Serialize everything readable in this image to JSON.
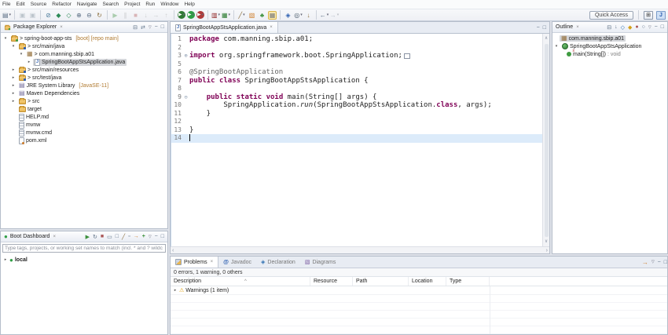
{
  "menu_bar": {
    "items": [
      "File",
      "Edit",
      "Source",
      "Refactor",
      "Navigate",
      "Search",
      "Project",
      "Run",
      "Window",
      "Help"
    ]
  },
  "toolbar": {
    "quick_access_label": "Quick Access",
    "items": [
      {
        "name": "new-wizard",
        "glyph": "▤",
        "dropdown": true
      },
      {
        "name": "save",
        "glyph": "▣",
        "disabled": true
      },
      {
        "name": "save-all",
        "glyph": "▣",
        "disabled": true
      },
      {
        "name": "skip-all-breakpoints",
        "glyph": "⊘"
      },
      {
        "name": "boot-dashboard-view",
        "glyph": "◆"
      },
      {
        "name": "new-spring-project",
        "glyph": "◇"
      },
      {
        "name": "add-item",
        "glyph": "⊕"
      },
      {
        "name": "remove-item",
        "glyph": "⊖"
      },
      {
        "name": "refresh",
        "glyph": "↻"
      },
      {
        "name": "resume",
        "glyph": "▶",
        "disabled": true
      },
      {
        "name": "suspend",
        "glyph": "∥",
        "disabled": true
      },
      {
        "name": "terminate",
        "glyph": "■",
        "disabled": true
      },
      {
        "name": "step-into",
        "glyph": "↓",
        "disabled": true
      },
      {
        "name": "step-over",
        "glyph": "→",
        "disabled": true
      },
      {
        "name": "step-return",
        "glyph": "↑",
        "disabled": true
      },
      {
        "name": "debug",
        "glyph": "▶",
        "dropdown": true
      },
      {
        "name": "run",
        "glyph": "▶",
        "dropdown": true
      },
      {
        "name": "profile",
        "glyph": "▶",
        "dropdown": true
      },
      {
        "name": "coverage",
        "glyph": "▥",
        "dropdown": true
      },
      {
        "name": "external-tools",
        "glyph": "▦",
        "dropdown": true
      },
      {
        "name": "edit-config",
        "glyph": "╱",
        "dropdown": true
      },
      {
        "name": "open-resource",
        "glyph": "▧"
      },
      {
        "name": "spring-symbol",
        "glyph": "♣"
      },
      {
        "name": "mark-occurrences",
        "glyph": "▦",
        "active": true
      },
      {
        "name": "open-type",
        "glyph": "◈"
      },
      {
        "name": "search",
        "glyph": "◎",
        "dropdown": true
      },
      {
        "name": "last-edit-location",
        "glyph": "↓"
      },
      {
        "name": "back",
        "glyph": "←",
        "dropdown": true
      },
      {
        "name": "forward",
        "glyph": "→",
        "dropdown": true,
        "disabled": true
      }
    ]
  },
  "icons": {
    "chevron_expanded": "▾",
    "chevron_collapsed": "▸",
    "view_menu": "▽",
    "minimize": "−",
    "maximize": "□",
    "close": "×",
    "fold_collapsed": "⊕",
    "fold_expanded": "⊖",
    "warning": "⚠",
    "java": "J",
    "at": "@",
    "declaration": "◈",
    "diagrams": "▧",
    "package": "▦",
    "library": "▤",
    "static_suffix": "s",
    "sort_indicator": "^",
    "scroll_up": "∧",
    "scroll_down": "∨",
    "scroll_left": "‹",
    "scroll_right": "›",
    "boot_dot": "●"
  },
  "package_explorer": {
    "title": "Package Explorer",
    "toolbar_icons": [
      {
        "name": "collapse-all",
        "glyph": "⊟"
      },
      {
        "name": "link-with-editor",
        "glyph": "⇄"
      }
    ],
    "tree": [
      {
        "state": "expanded",
        "icon": "project",
        "label": "> spring-boot-app-sts",
        "decoration": "[boot] [repo main]"
      },
      {
        "state": "expanded",
        "icon": "src-folder",
        "label": "> src/main/java"
      },
      {
        "state": "expanded",
        "icon": "package",
        "label": "> com.manning.sbip.a01"
      },
      {
        "state": "collapsed",
        "icon": "java-file",
        "label": "SpringBootAppStsApplication.java",
        "selected": true
      },
      {
        "state": "collapsed",
        "icon": "src-folder",
        "label": "> src/main/resources"
      },
      {
        "state": "collapsed",
        "icon": "src-folder",
        "label": "> src/test/java"
      },
      {
        "state": "collapsed",
        "icon": "library",
        "label": "JRE System Library",
        "decoration": "[JavaSE-11]"
      },
      {
        "state": "collapsed",
        "icon": "library",
        "label": "Maven Dependencies"
      },
      {
        "state": "collapsed",
        "icon": "folder",
        "label": "> src"
      },
      {
        "icon": "folder",
        "label": "target"
      },
      {
        "icon": "file",
        "label": "HELP.md"
      },
      {
        "icon": "file",
        "label": "mvnw"
      },
      {
        "icon": "file",
        "label": "mvnw.cmd"
      },
      {
        "icon": "xml-file",
        "label": "pom.xml"
      }
    ]
  },
  "boot_dashboard": {
    "title": "Boot Dashboard",
    "filter_text": "Type tags, projects, or working set names to match (incl. * and ? wildc",
    "toolbar_icons": [
      {
        "name": "start",
        "glyph": "▶"
      },
      {
        "name": "restart",
        "glyph": "↻"
      },
      {
        "name": "stop",
        "glyph": "■"
      },
      {
        "name": "open-console",
        "glyph": "▭"
      },
      {
        "name": "open-properties",
        "glyph": "□"
      },
      {
        "name": "edit-config",
        "glyph": "╱"
      },
      {
        "name": "duplicate-config",
        "glyph": "▫"
      },
      {
        "name": "open-browser",
        "glyph": "→"
      },
      {
        "name": "add-config",
        "glyph": "+"
      }
    ],
    "tree": [
      {
        "state": "collapsed",
        "icon": "boot",
        "label": "local"
      }
    ]
  },
  "editor": {
    "tab": {
      "label": "SpringBootAppStsApplication.java"
    },
    "colors": {
      "keyword": "#7f0055",
      "annotation": "#646464",
      "plain": "#000000",
      "current_line": "#dcebfa",
      "line_number": "#787878"
    },
    "lines": [
      {
        "num": "1",
        "segments": [
          {
            "t": "package",
            "type": "keyword"
          },
          {
            "t": " com.manning.sbip.a01;",
            "type": "plain"
          }
        ]
      },
      {
        "num": "2",
        "segments": []
      },
      {
        "num": "3",
        "fold": "collapsed",
        "fold_box": true,
        "segments": [
          {
            "t": "import",
            "type": "keyword"
          },
          {
            "t": " org.springframework.boot.SpringApplication;",
            "type": "plain"
          }
        ]
      },
      {
        "num": "5",
        "segments": []
      },
      {
        "num": "6",
        "segments": [
          {
            "t": "@SpringBootApplication",
            "type": "annotation"
          }
        ]
      },
      {
        "num": "7",
        "segments": [
          {
            "t": "public",
            "type": "keyword"
          },
          {
            "t": " ",
            "type": "plain"
          },
          {
            "t": "class",
            "type": "keyword"
          },
          {
            "t": " SpringBootAppStsApplication {",
            "type": "plain"
          }
        ]
      },
      {
        "num": "8",
        "segments": []
      },
      {
        "num": "9",
        "fold": "expanded",
        "segments": [
          {
            "t": "    ",
            "type": "plain"
          },
          {
            "t": "public",
            "type": "keyword"
          },
          {
            "t": " ",
            "type": "plain"
          },
          {
            "t": "static",
            "type": "keyword"
          },
          {
            "t": " ",
            "type": "plain"
          },
          {
            "t": "void",
            "type": "keyword"
          },
          {
            "t": " main(String[] args) {",
            "type": "plain"
          }
        ]
      },
      {
        "num": "10",
        "segments": [
          {
            "t": "        SpringApplication.",
            "type": "plain"
          },
          {
            "t": "run",
            "type": "static-method-italic"
          },
          {
            "t": "(SpringBootAppStsApplication.",
            "type": "plain"
          },
          {
            "t": "class",
            "type": "keyword"
          },
          {
            "t": ", args);",
            "type": "plain"
          }
        ]
      },
      {
        "num": "11",
        "segments": [
          {
            "t": "    }",
            "type": "plain"
          }
        ]
      },
      {
        "num": "12",
        "segments": []
      },
      {
        "num": "13",
        "segments": [
          {
            "t": "}",
            "type": "plain"
          }
        ]
      },
      {
        "num": "14",
        "current": true,
        "segments": []
      }
    ]
  },
  "outline": {
    "title": "Outline",
    "toolbar_icons": [
      {
        "name": "collapse-all",
        "glyph": "⊟"
      },
      {
        "name": "sort",
        "glyph": "↓"
      },
      {
        "name": "hide-fields",
        "glyph": "◇"
      },
      {
        "name": "hide-static-members",
        "glyph": "◆"
      },
      {
        "name": "hide-non-public",
        "glyph": "●"
      },
      {
        "name": "hide-local-types",
        "glyph": "○"
      }
    ],
    "items": [
      {
        "icon": "package",
        "label": "com.manning.sbip.a01",
        "selected": true
      },
      {
        "state": "expanded",
        "icon": "class",
        "label": "SpringBootAppStsApplication"
      },
      {
        "icon": "static-method",
        "label": "main(String[])",
        "suffix": " : void"
      }
    ]
  },
  "problems": {
    "tabs": [
      {
        "label": "Problems",
        "active": true
      },
      {
        "label": "Javadoc"
      },
      {
        "label": "Declaration"
      },
      {
        "label": "Diagrams"
      }
    ],
    "status": "0 errors, 1 warning, 0 others",
    "columns": [
      "Description",
      "Resource",
      "Path",
      "Location",
      "Type"
    ],
    "rows": [
      {
        "chevron": "collapsed",
        "icon": "warning",
        "label": "Warnings (1 item)"
      }
    ]
  }
}
